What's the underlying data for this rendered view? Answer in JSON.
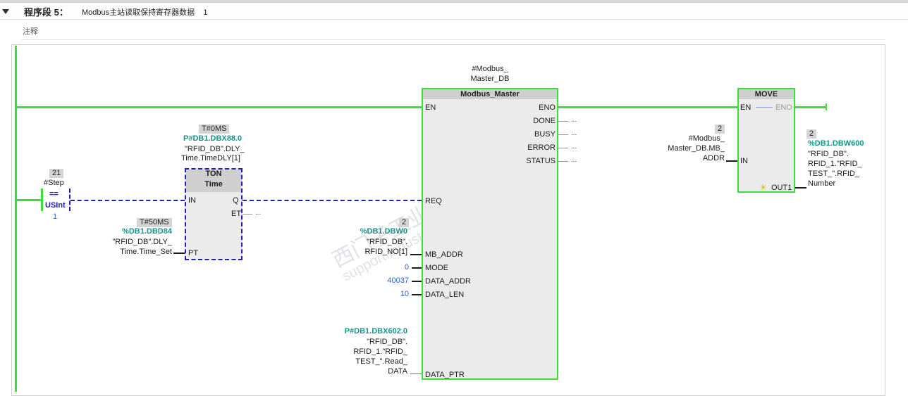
{
  "segment": {
    "title": "程序段 5：",
    "description": "Modbus主站读取保持寄存器数据",
    "number": "1",
    "comment": "注释"
  },
  "compare": {
    "value": "21",
    "operand": "#Step",
    "op": "==",
    "type": "USInt",
    "const": "1"
  },
  "ton": {
    "init_value": "T#0MS",
    "db_addr": "P#DB1.DBX88.0",
    "db_name": "\"RFID_DB\".DLY_",
    "db_name2": "Time.TimeDLY[1]",
    "title": "TON",
    "subtitle": "Time",
    "pin_in": "IN",
    "pin_q": "Q",
    "pin_et": "ET",
    "pin_pt": "PT",
    "et_out": "...",
    "pt_value": "T#50MS",
    "pt_addr": "%DB1.DBD84",
    "pt_name1": "\"RFID_DB\".DLY_",
    "pt_name2": "Time.Time_Set"
  },
  "modbus": {
    "instance1": "#Modbus_",
    "instance2": "Master_DB",
    "title": "Modbus_Master",
    "pin_en": "EN",
    "pin_eno": "ENO",
    "pin_done": "DONE",
    "pin_busy": "BUSY",
    "pin_error": "ERROR",
    "pin_status": "STATUS",
    "pin_req": "REQ",
    "pin_mb_addr": "MB_ADDR",
    "pin_mode": "MODE",
    "pin_data_addr": "DATA_ADDR",
    "pin_data_len": "DATA_LEN",
    "pin_data_ptr": "DATA_PTR",
    "out_ellipsis": "...",
    "mb_addr_value": "2",
    "mb_addr_addr": "%DB1.DBW0",
    "mb_addr_name1": "\"RFID_DB\".",
    "mb_addr_name2": "RFID_NO[1]",
    "mode_value": "0",
    "data_addr_value": "40037",
    "data_len_value": "10",
    "ptr_addr": "P#DB1.DBX602.0",
    "ptr_name1": "\"RFID_DB\".",
    "ptr_name2": "RFID_1.\"RFID_",
    "ptr_name3": "TEST_\".Read_",
    "ptr_name4": "DATA"
  },
  "move": {
    "title": "MOVE",
    "pin_en": "EN",
    "pin_eno": "ENO",
    "pin_in": "IN",
    "pin_out": "OUT1",
    "in_value": "2",
    "in_name1": "#Modbus_",
    "in_name2": "Master_DB.MB_",
    "in_name3": "ADDR",
    "out_value": "2",
    "out_addr": "%DB1.DBW600",
    "out_name1": "\"RFID_DB\".",
    "out_name2": "RFID_1.\"RFID_",
    "out_name3": "TEST_\".RFID_",
    "out_name4": "Number"
  },
  "colors": {
    "power_flow": "#38e038",
    "dashed_wire": "#1f1fb0",
    "address": "#16948a",
    "constant": "#2c63c4"
  },
  "watermark": {
    "line1": "西门子工业 技术论坛",
    "line2": "support.industry.siemens.com"
  }
}
